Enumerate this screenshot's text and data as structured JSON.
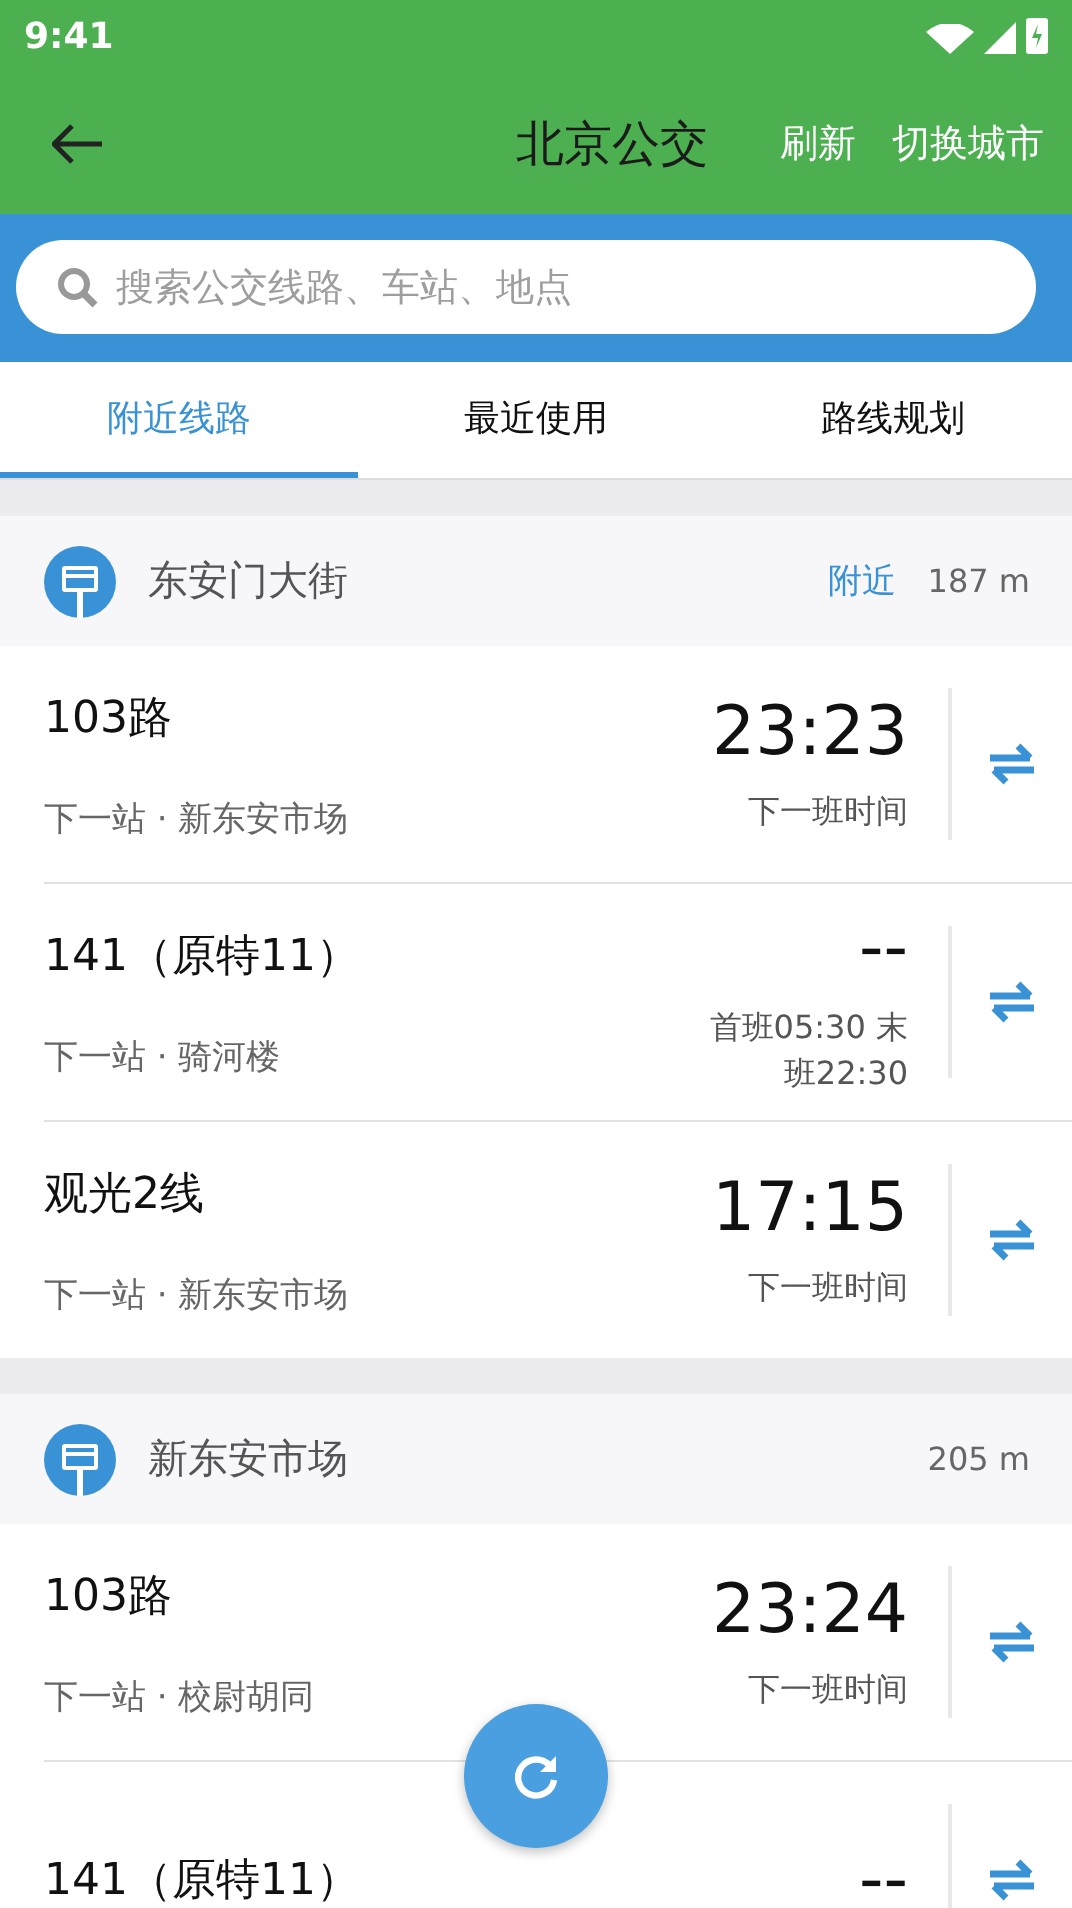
{
  "status_bar": {
    "time": "9:41"
  },
  "app_bar": {
    "title": "北京公交",
    "actions": [
      "刷新",
      "切换城市"
    ]
  },
  "search": {
    "placeholder": "搜索公交线路、车站、地点"
  },
  "tabs": [
    {
      "label": "附近线路",
      "selected": true
    },
    {
      "label": "最近使用",
      "selected": false
    },
    {
      "label": "路线规划",
      "selected": false
    }
  ],
  "stations": [
    {
      "name": "东安门大街",
      "tag": "附近",
      "distance": "187 m",
      "routes": [
        {
          "kind": "time",
          "name": "103路",
          "next_stop": "下一站 · 新东安市场",
          "time": "23:23",
          "note": "下一班时间"
        },
        {
          "kind": "schedule",
          "name": "141（原特11）",
          "next_stop": "下一站 · 骑河楼",
          "time": "--",
          "note": "首班05:30 末班22:30"
        },
        {
          "kind": "time",
          "name": "观光2线",
          "next_stop": "下一站 · 新东安市场",
          "time": "17:15",
          "note": "下一班时间"
        }
      ]
    },
    {
      "name": "新东安市场",
      "distance": "205 m",
      "routes": [
        {
          "kind": "time",
          "name": "103路",
          "next_stop": "下一站 · 校尉胡同",
          "time": "23:24",
          "note": "下一班时间"
        },
        {
          "kind": "cut",
          "name": "141（原特11）",
          "time": "--"
        }
      ]
    }
  ]
}
